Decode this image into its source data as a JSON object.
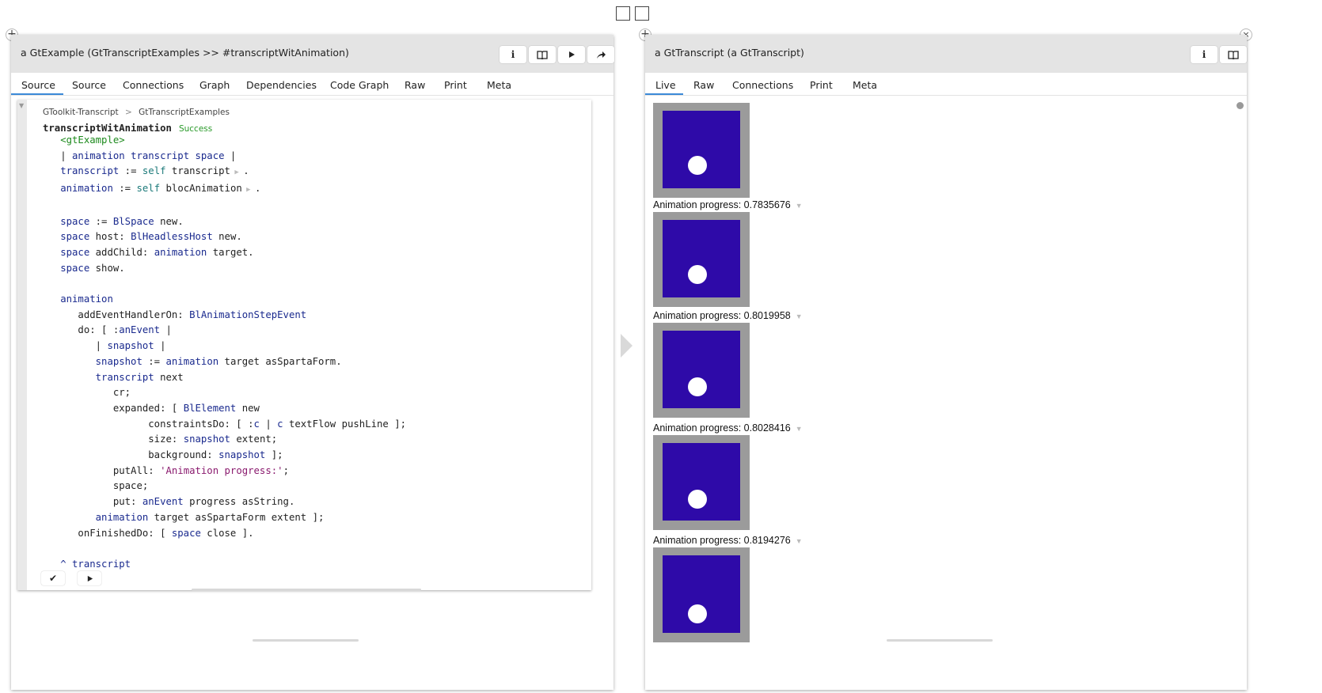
{
  "left_pane": {
    "title": "a GtExample (GtTranscriptExamples >> #transcriptWitAnimation)",
    "tabs": [
      "Source",
      "Source",
      "Connections",
      "Graph",
      "Dependencies",
      "Code Graph",
      "Raw",
      "Print",
      "Meta"
    ],
    "active_tab": "Source",
    "header_buttons": [
      "info-icon",
      "book-icon",
      "play-icon",
      "share-icon"
    ],
    "breadcrumb": {
      "package": "GToolkit-Transcript",
      "separator": ">",
      "class": "GtTranscriptExamples"
    },
    "method_name": "transcriptWitAnimation",
    "status": "Success",
    "footer_buttons": [
      "check-icon",
      "play-icon"
    ]
  },
  "right_pane": {
    "title": "a GtTranscript (a GtTranscript)",
    "tabs": [
      "Live",
      "Raw",
      "Connections",
      "Print",
      "Meta"
    ],
    "active_tab": "Live",
    "header_buttons": [
      "info-icon",
      "book-icon"
    ],
    "progress_label": "Animation progress:",
    "progress_values": [
      "0.7835676",
      "0.8019958",
      "0.8028416",
      "0.8194276"
    ]
  },
  "colors": {
    "accent": "#3b8ad8",
    "header_bg": "#e4e4e4",
    "snapshot_frame": "#9b9b9b",
    "snapshot_fill": "#2e0aa8",
    "keyword": "#1a2a8e",
    "pragma": "#1d8a1d",
    "string": "#8a1a6e"
  }
}
